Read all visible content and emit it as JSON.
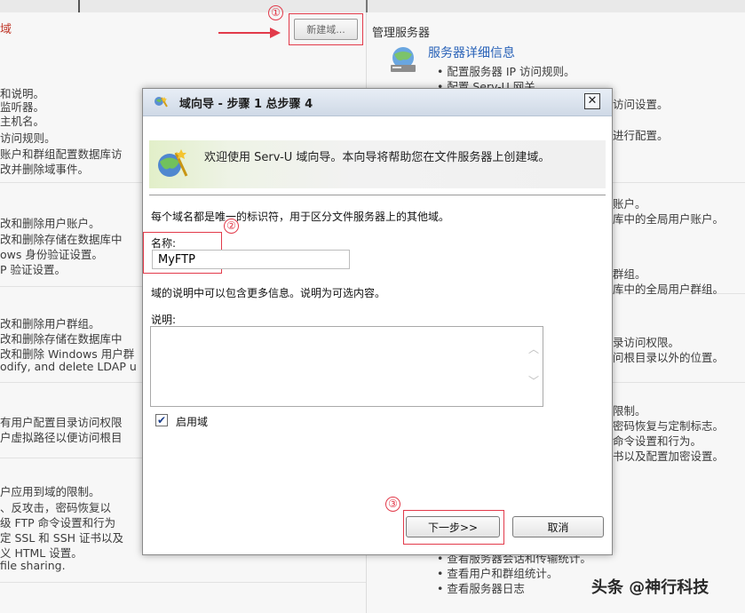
{
  "background": {
    "left_fragment": "域",
    "new_domain_button": "新建域...",
    "manage_server_title": "管理服务器",
    "server_detail_title": "服务器详细信息",
    "left_lines": [
      "和说明。",
      "监听器。",
      "主机名。",
      "访问规则。",
      "账户和群组配置数据库访",
      "改并删除域事件。",
      "改和删除用户账户。",
      "改和删除存储在数据库中",
      "ows 身份验证设置。",
      "P 验证设置。",
      "改和删除用户群组。",
      "改和删除存储在数据库中",
      "改和删除 Windows 用户群",
      "odify, and delete LDAP u",
      "有用户配置目录访问权限",
      "户虚拟路径以便访问根目",
      "户应用到域的限制。",
      "、反攻击，密码恢复以",
      "级 FTP 命令设置和行为",
      "定 SSL 和 SSH 证书以及",
      "义 HTML 设置。",
      "file sharing."
    ],
    "right_lines": [
      "• 配置服务器 IP 访问规则。",
      "• 配置 Serv-U 网关",
      "访问设置。",
      "进行配置。",
      "账户。",
      "库中的全局用户账户。",
      "群组。",
      "库中的全局用户群组。",
      "录访问权限。",
      "问根目录以外的位置。",
      "限制。",
      "密码恢复与定制标志。",
      "命令设置和行为。",
      "书以及配置加密设置。",
      "• 查看服务器会话和传输统计。",
      "• 查看用户和群组统计。",
      "• 查看服务器日志"
    ]
  },
  "annotations": {
    "step1": "①",
    "step2": "②",
    "step3": "③"
  },
  "dialog": {
    "title": "域向导 - 步骤 1 总步骤 4",
    "close_label": "☒",
    "welcome_text": "欢迎使用 Serv-U 域向导。本向导将帮助您在文件服务器上创建域。",
    "name_hint": "每个域名都是唯一的标识符，用于区分文件服务器上的其他域。",
    "name_label": "名称:",
    "name_value": "MyFTP",
    "desc_hint": "域的说明中可以包含更多信息。说明为可选内容。",
    "desc_label": "说明:",
    "desc_value": "",
    "enable_label": "启用域",
    "enable_checked": true,
    "next_button": "下一步>>",
    "cancel_button": "取消"
  },
  "watermark": "头条 @神行科技",
  "colors": {
    "annotation_red": "#e23a4a",
    "link_blue": "#2a63b8"
  }
}
